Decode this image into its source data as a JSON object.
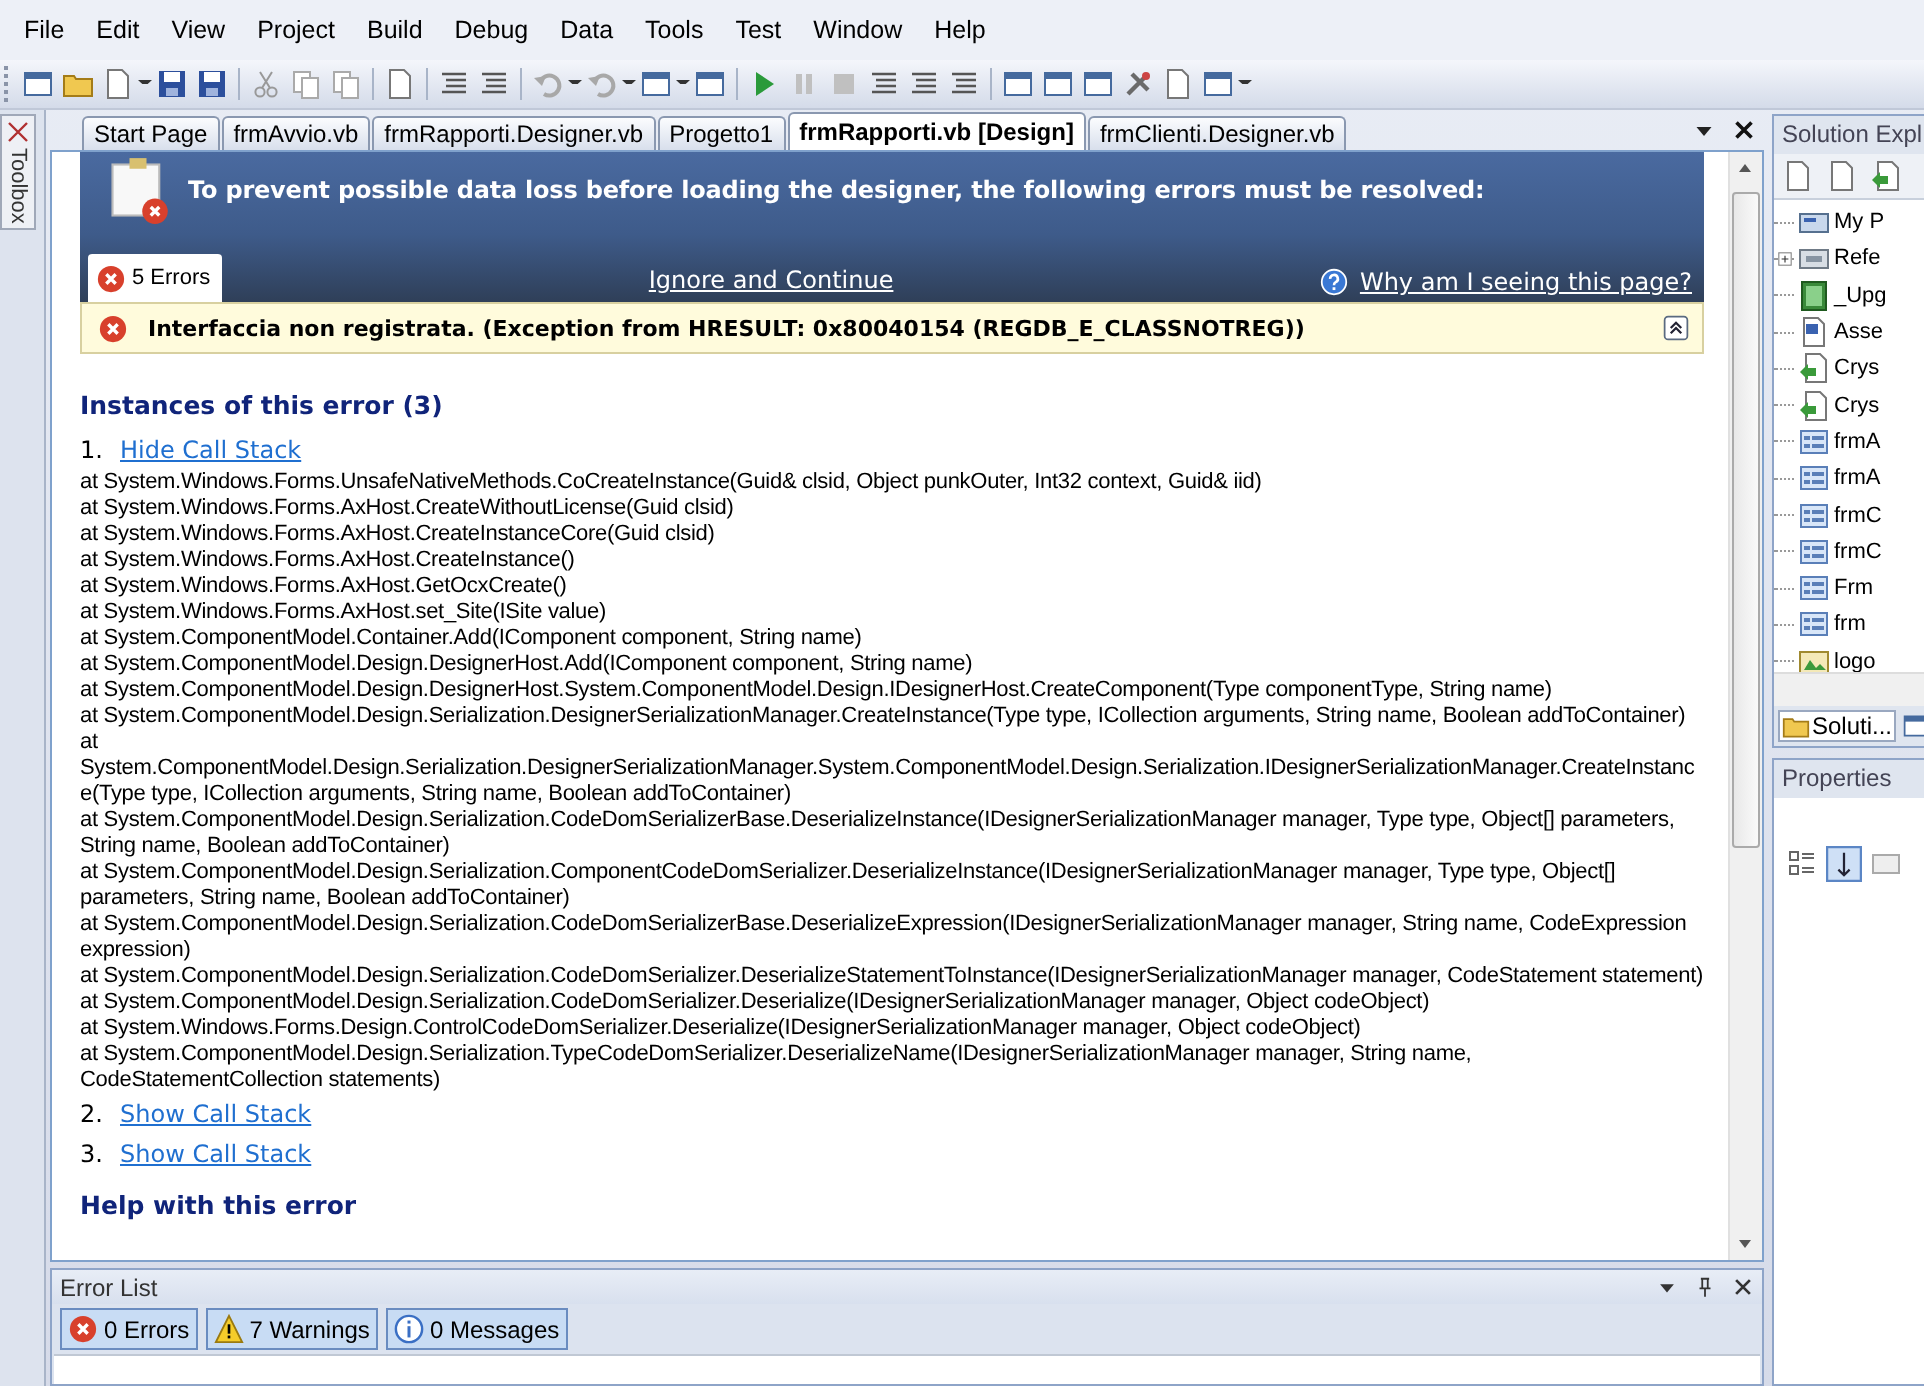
{
  "menu": [
    "File",
    "Edit",
    "View",
    "Project",
    "Build",
    "Debug",
    "Data",
    "Tools",
    "Test",
    "Window",
    "Help"
  ],
  "toolbox": {
    "label": "Toolbox"
  },
  "tabs": [
    {
      "label": "Start Page",
      "selected": false
    },
    {
      "label": "frmAvvio.vb",
      "selected": false
    },
    {
      "label": "frmRapporti.Designer.vb",
      "selected": false
    },
    {
      "label": "Progetto1",
      "selected": false
    },
    {
      "label": "frmRapporti.vb [Design]",
      "selected": true
    },
    {
      "label": "frmClienti.Designer.vb",
      "selected": false
    }
  ],
  "designer": {
    "banner": "To prevent possible data loss before loading the designer, the following errors must be resolved:",
    "errors_tab": "5 Errors",
    "ignore_link": "Ignore and Continue",
    "why_link": "Why am I seeing this page?",
    "error_message": "Interfaccia non registrata. (Exception from HRESULT: 0x80040154 (REGDB_E_CLASSNOTREG))",
    "error_expanded": true,
    "instances_heading": "Instances of this error (3)",
    "instances": [
      {
        "number": "1.",
        "link": "Hide Call Stack",
        "stack": [
          "at System.Windows.Forms.UnsafeNativeMethods.CoCreateInstance(Guid& clsid, Object punkOuter, Int32 context, Guid& iid)",
          "at System.Windows.Forms.AxHost.CreateWithoutLicense(Guid clsid)",
          "at System.Windows.Forms.AxHost.CreateInstanceCore(Guid clsid)",
          "at System.Windows.Forms.AxHost.CreateInstance()",
          "at System.Windows.Forms.AxHost.GetOcxCreate()",
          "at System.Windows.Forms.AxHost.set_Site(ISite value)",
          "at System.ComponentModel.Container.Add(IComponent component, String name)",
          "at System.ComponentModel.Design.DesignerHost.Add(IComponent component, String name)",
          "at System.ComponentModel.Design.DesignerHost.System.ComponentModel.Design.IDesignerHost.CreateComponent(Type componentType, String name)",
          "at System.ComponentModel.Design.Serialization.DesignerSerializationManager.CreateInstance(Type type, ICollection arguments, String name, Boolean addToContainer)",
          "at System.ComponentModel.Design.Serialization.DesignerSerializationManager.System.ComponentModel.Design.Serialization.IDesignerSerializationManager.CreateInstance(Type type, ICollection arguments, String name, Boolean addToContainer)",
          "at System.ComponentModel.Design.Serialization.CodeDomSerializerBase.DeserializeInstance(IDesignerSerializationManager manager, Type type, Object[] parameters, String name, Boolean addToContainer)",
          "at System.ComponentModel.Design.Serialization.ComponentCodeDomSerializer.DeserializeInstance(IDesignerSerializationManager manager, Type type, Object[] parameters, String name, Boolean addToContainer)",
          "at System.ComponentModel.Design.Serialization.CodeDomSerializerBase.DeserializeExpression(IDesignerSerializationManager manager, String name, CodeExpression expression)",
          "at System.ComponentModel.Design.Serialization.CodeDomSerializer.DeserializeStatementToInstance(IDesignerSerializationManager manager, CodeStatement statement)",
          "at System.ComponentModel.Design.Serialization.CodeDomSerializer.Deserialize(IDesignerSerializationManager manager, Object codeObject)",
          "at System.Windows.Forms.Design.ControlCodeDomSerializer.Deserialize(IDesignerSerializationManager manager, Object codeObject)",
          "at System.ComponentModel.Design.Serialization.TypeCodeDomSerializer.DeserializeName(IDesignerSerializationManager manager, String name, CodeStatementCollection statements)"
        ]
      },
      {
        "number": "2.",
        "link": "Show Call Stack"
      },
      {
        "number": "3.",
        "link": "Show Call Stack"
      }
    ],
    "help_heading": "Help with this error"
  },
  "solution_explorer": {
    "title": "Solution Expl",
    "items": [
      {
        "label": "My P",
        "kind": "project",
        "expandable": false
      },
      {
        "label": "Refe",
        "kind": "references",
        "expandable": true
      },
      {
        "label": "_Upg",
        "kind": "report",
        "expandable": false
      },
      {
        "label": "Asse",
        "kind": "vbfile",
        "expandable": false
      },
      {
        "label": "Crys",
        "kind": "crystal",
        "expandable": false
      },
      {
        "label": "Crys",
        "kind": "crystal",
        "expandable": false
      },
      {
        "label": "frmA",
        "kind": "form",
        "expandable": false
      },
      {
        "label": "frmA",
        "kind": "form",
        "expandable": false
      },
      {
        "label": "frmC",
        "kind": "form",
        "expandable": false
      },
      {
        "label": "frmC",
        "kind": "form",
        "expandable": false
      },
      {
        "label": "Frm",
        "kind": "form",
        "expandable": false
      },
      {
        "label": "frm",
        "kind": "form",
        "expandable": false
      },
      {
        "label": "logo",
        "kind": "image",
        "expandable": false
      }
    ],
    "tab": "Soluti..."
  },
  "properties": {
    "title": "Properties"
  },
  "error_list": {
    "title": "Error List",
    "filters": [
      {
        "label": "0 Errors",
        "kind": "error",
        "selected": true
      },
      {
        "label": "7 Warnings",
        "kind": "warning",
        "selected": true
      },
      {
        "label": "0 Messages",
        "kind": "info",
        "selected": true
      }
    ]
  }
}
